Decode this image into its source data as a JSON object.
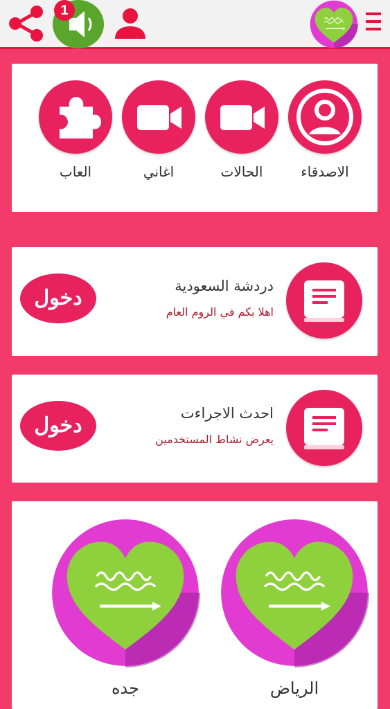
{
  "topbar": {
    "notification_count": "1",
    "icons": [
      "share-icon",
      "speaker-icon",
      "user-icon",
      "saudi-heart-logo",
      "menu-icon"
    ]
  },
  "features": [
    {
      "label": "الاصدقاء",
      "icon": "person-icon"
    },
    {
      "label": "الحالات",
      "icon": "video-camera-icon"
    },
    {
      "label": "اغاني",
      "icon": "video-camera-icon"
    },
    {
      "label": "العاب",
      "icon": "puzzle-icon"
    }
  ],
  "chat_room": {
    "title": "دردشة السعودية",
    "subtitle": "اهلا بكم في الروم العام",
    "enter_label": "دخول"
  },
  "activity": {
    "title": "احدث الاجراءت",
    "subtitle": "يعرض نشاط المستخدمين",
    "enter_label": "دخول"
  },
  "rooms": [
    {
      "label": "الرياض"
    },
    {
      "label": "جده"
    }
  ],
  "colors": {
    "accent": "#e8215f",
    "background": "#f23b6a",
    "topbar": "#f2f2f2",
    "speaker_green": "#5aa52c",
    "heart_green": "#8ed13d",
    "heart_ring": "#e23bd2"
  }
}
